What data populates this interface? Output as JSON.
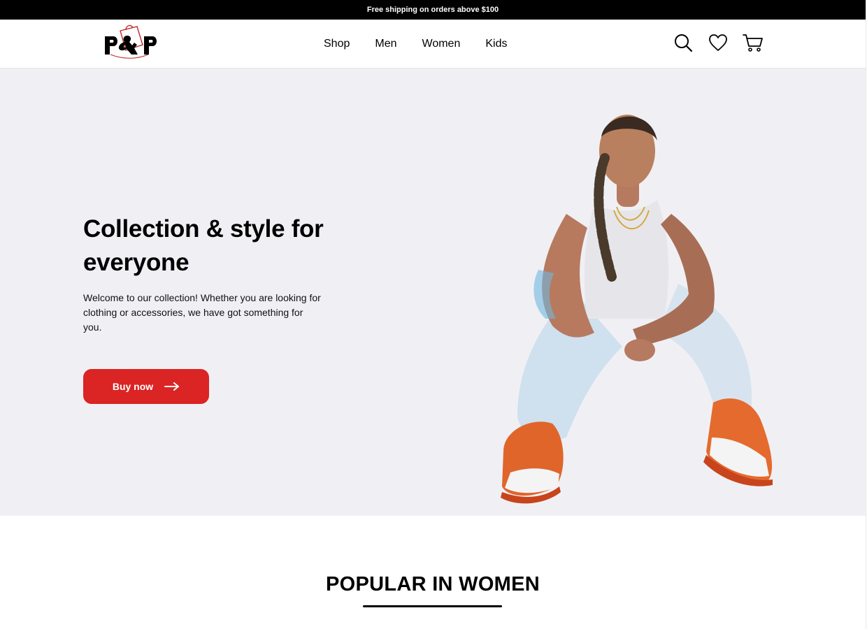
{
  "announcement": {
    "text": "Free shipping on orders above $100"
  },
  "header": {
    "logo": {
      "text": "P&P",
      "icon": "shopping-bag-logo"
    },
    "nav": [
      {
        "label": "Shop"
      },
      {
        "label": "Men"
      },
      {
        "label": "Women"
      },
      {
        "label": "Kids"
      }
    ],
    "icons": [
      "search-icon",
      "heart-icon",
      "cart-icon"
    ]
  },
  "hero": {
    "title": "Collection & style for everyone",
    "description": "Welcome to our collection! Whether you are looking for clothing or accessories, we have got something for you.",
    "button_label": "Buy now",
    "button_icon": "arrow-right-icon",
    "image": "model-sitting-sneakers"
  },
  "section": {
    "title": "POPULAR IN WOMEN"
  },
  "colors": {
    "accent": "#db2424",
    "hero_bg": "#f0f0f4",
    "topbar_bg": "#000000"
  }
}
